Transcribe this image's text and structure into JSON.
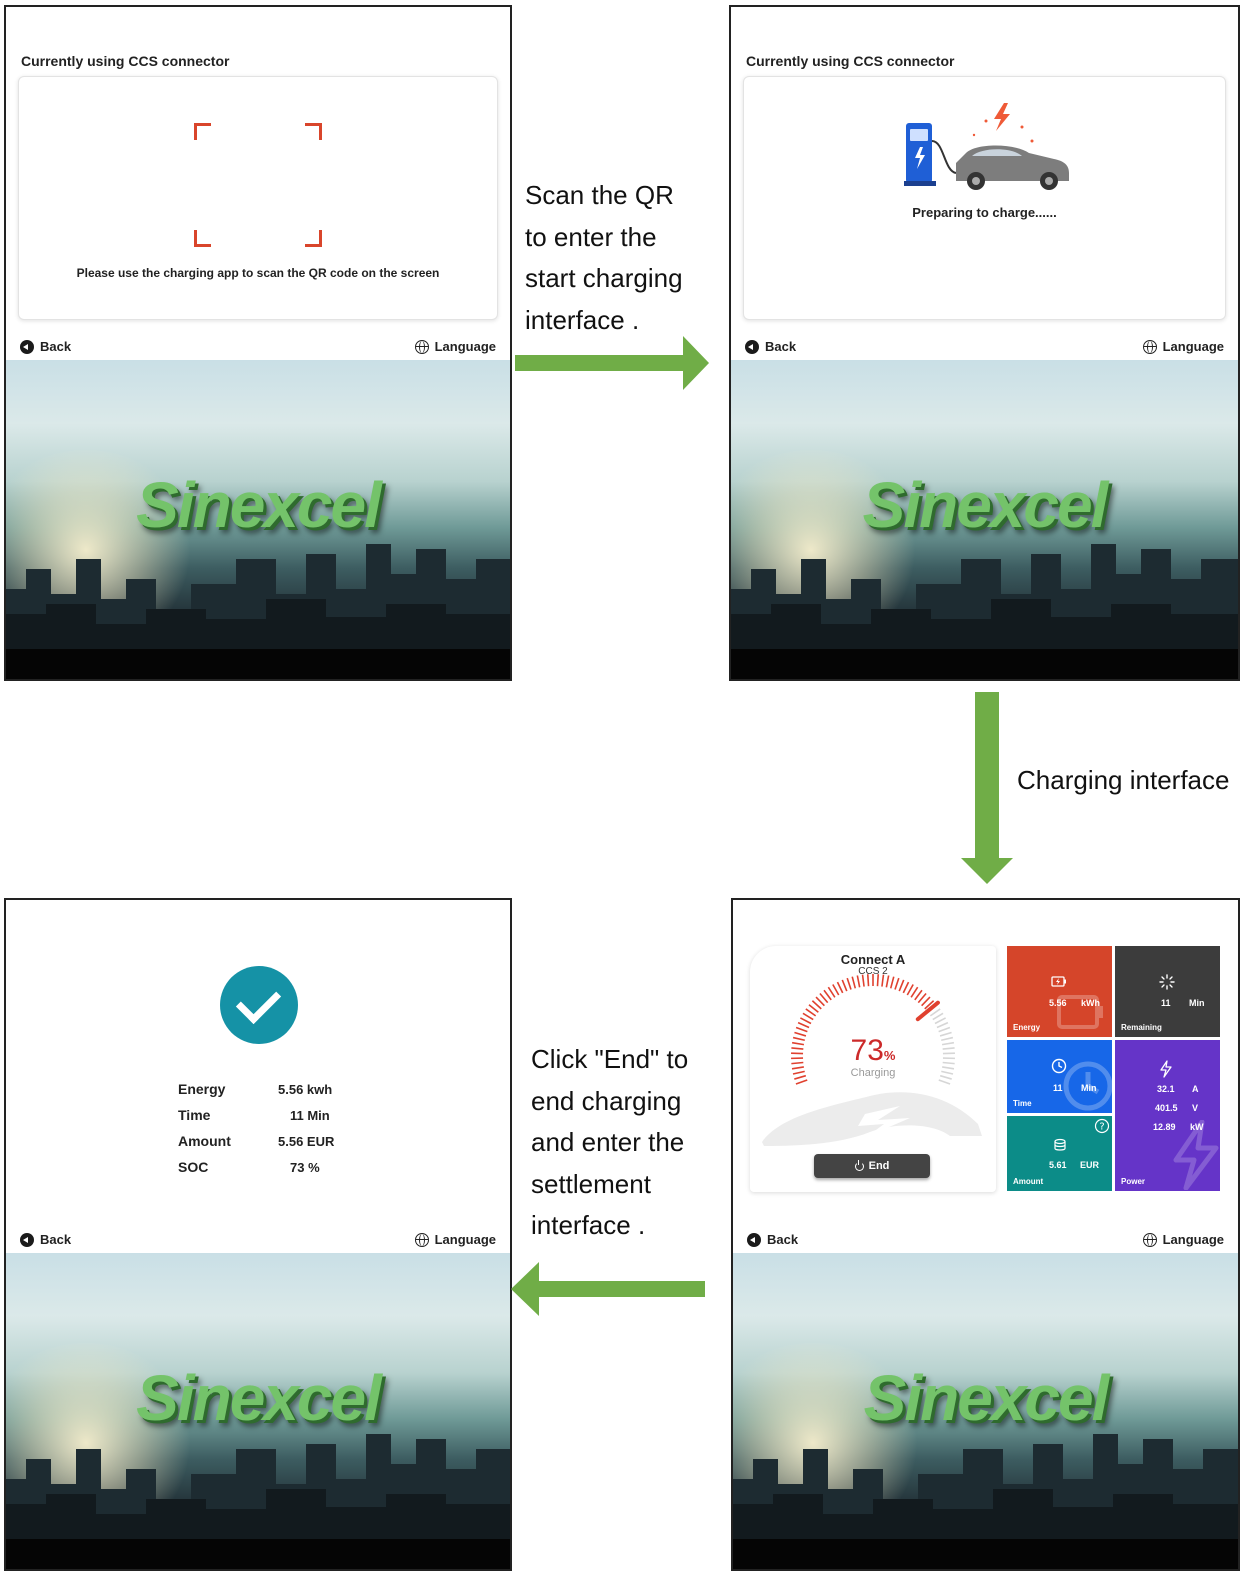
{
  "panel1": {
    "connector_title": "Currently using CCS connector",
    "qr_instruction": "Please use the charging app to scan the QR code on the screen",
    "back_label": "Back",
    "language_label": "Language",
    "brand": "Sinexcel"
  },
  "panel2": {
    "connector_title": "Currently using CCS connector",
    "status": "Preparing to charge......",
    "back_label": "Back",
    "language_label": "Language",
    "brand": "Sinexcel"
  },
  "panel3": {
    "connect_title": "Connect A",
    "connect_sub": "CCS 2",
    "soc_value": "73",
    "soc_unit": "%",
    "charging_status": "Charging",
    "end_label": "End",
    "energy": {
      "value": "5.56",
      "unit": "kWh",
      "label": "Energy"
    },
    "remaining": {
      "value": "11",
      "unit": "Min",
      "label": "Remaining"
    },
    "time": {
      "value": "11",
      "unit": "Min",
      "label": "Time"
    },
    "amount": {
      "value": "5.61",
      "unit": "EUR",
      "label": "Amount"
    },
    "power": {
      "current": "32.1",
      "current_unit": "A",
      "voltage": "401.5",
      "voltage_unit": "V",
      "power": "12.89",
      "power_unit": "kW",
      "label": "Power"
    },
    "soc_fraction": 0.73,
    "back_label": "Back",
    "language_label": "Language",
    "brand": "Sinexcel"
  },
  "panel4": {
    "rows": [
      {
        "label": "Energy",
        "value": "5.56 kwh"
      },
      {
        "label": "Time",
        "value": "11 Min"
      },
      {
        "label": "Amount",
        "value": "5.56 EUR"
      },
      {
        "label": "SOC",
        "value": "73 %"
      }
    ],
    "back_label": "Back",
    "language_label": "Language",
    "brand": "Sinexcel"
  },
  "annotations": {
    "step1": [
      "Scan the QR",
      "to enter the",
      "start charging",
      "interface ."
    ],
    "step2": [
      "Charging interface"
    ],
    "step3": [
      "Click \"End\" to",
      "end charging",
      "and enter the",
      "settlement",
      "interface ."
    ]
  },
  "colors": {
    "arrow": "#70ad47",
    "qr_corner": "#d9452b",
    "soc_red": "#cc2a2a",
    "energy_tile": "#d5452a",
    "remaining_tile": "#3c3c3c",
    "time_tile": "#1767e8",
    "power_tile": "#6534c8",
    "amount_tile": "#0c8c88",
    "check": "#1592a6"
  }
}
